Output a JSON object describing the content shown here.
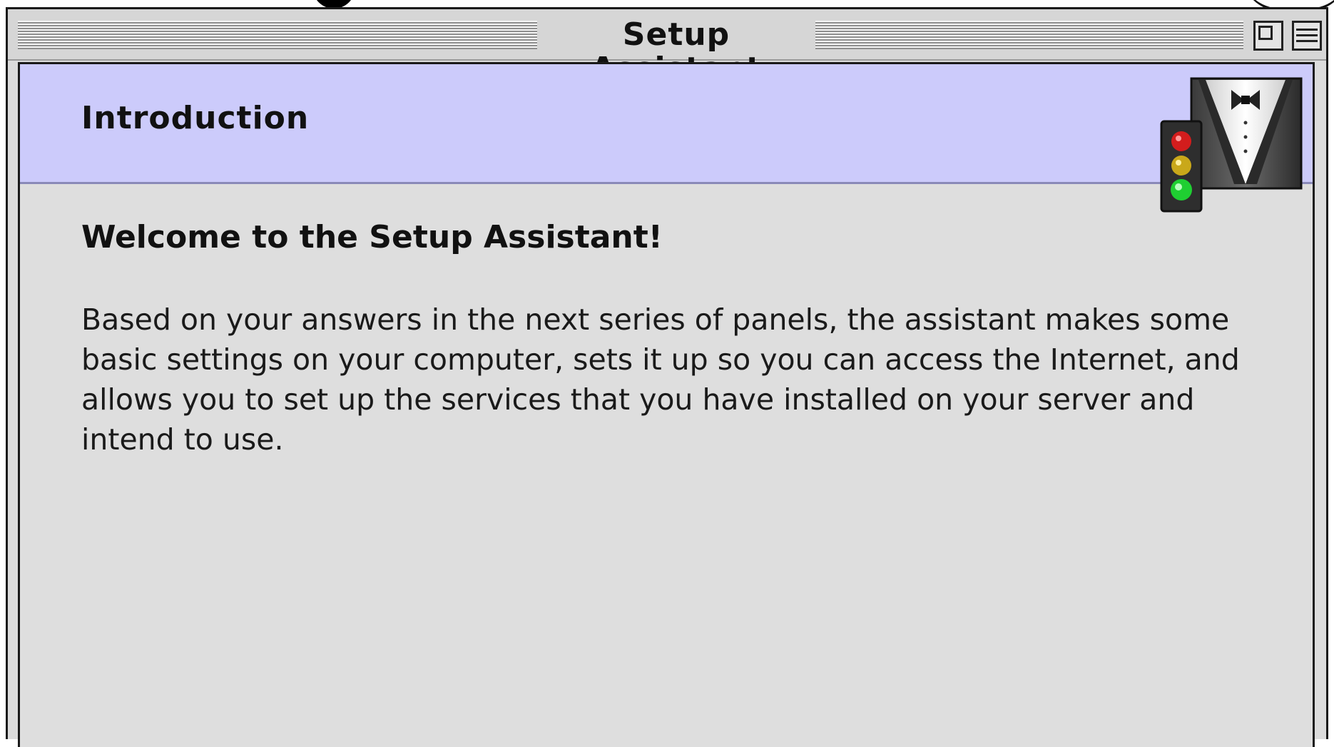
{
  "window": {
    "title": "Setup Assistant"
  },
  "panel": {
    "section_title": "Introduction",
    "welcome_heading": "Welcome to the Setup Assistant!",
    "body": "Based on your answers in the next series of panels, the assistant makes some basic settings on your computer, sets it up so you can access the Internet, and allows you to set up the services that you have installed on your server and intend to use."
  },
  "icons": {
    "zoom": "zoom-box-icon",
    "collapse": "windowshade-icon",
    "logo": "setup-assistant-tuxedo-traffic-light-icon"
  },
  "colors": {
    "header_band": "#cccbfb",
    "window_bg": "#dedede"
  }
}
